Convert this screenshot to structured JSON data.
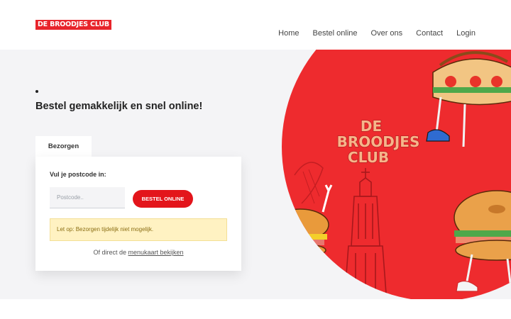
{
  "header": {
    "logo_text": "DE BROODJES CLUB",
    "nav": [
      "Home",
      "Bestel online",
      "Over ons",
      "Contact",
      "Login"
    ]
  },
  "hero": {
    "tagline": "Bestel gemakkelijk en snel online!",
    "illustration_text": [
      "DE",
      "BROODJES",
      "CLUB"
    ]
  },
  "order_form": {
    "tab_label": "Bezorgen",
    "postcode_label": "Vul je postcode in:",
    "postcode_placeholder": "Postcode..",
    "postcode_value": "",
    "submit_label": "BESTEL ONLINE",
    "notice": "Let op: Bezorgen tijdelijk niet mogelijk.",
    "menu_prefix": "Of direct de",
    "menu_link": "menukaart bekijken"
  },
  "colors": {
    "brand_red": "#e3151b",
    "notice_bg": "#fff2c2",
    "hero_bg": "#f4f4f6",
    "illustration_text": "#f6b58a"
  },
  "icons": {
    "illustration": "sandwich-mascots-tower-illustration"
  }
}
